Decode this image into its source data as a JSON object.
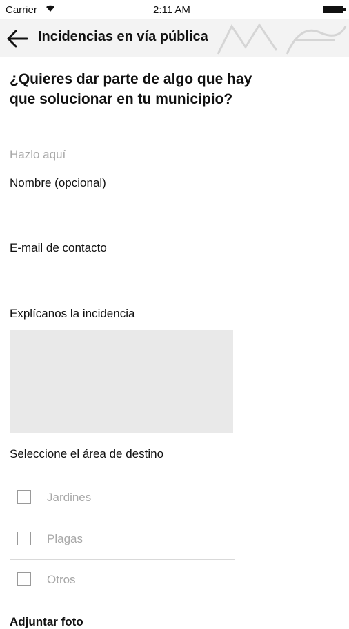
{
  "status_bar": {
    "carrier": "Carrier",
    "time": "2:11 AM"
  },
  "nav": {
    "title": "Incidencias en vía pública"
  },
  "form": {
    "question": "¿Quieres dar parte de algo que hay que solucionar en tu municipio?",
    "hint": "Hazlo aquí",
    "name_label": "Nombre (opcional)",
    "email_label": "E-mail de contacto",
    "description_label": "Explícanos la incidencia",
    "area_label": "Seleccione el área de destino",
    "options": [
      {
        "label": "Jardines",
        "checked": false
      },
      {
        "label": "Plagas",
        "checked": false
      },
      {
        "label": "Otros",
        "checked": false
      }
    ],
    "attach_label": "Adjuntar foto"
  }
}
